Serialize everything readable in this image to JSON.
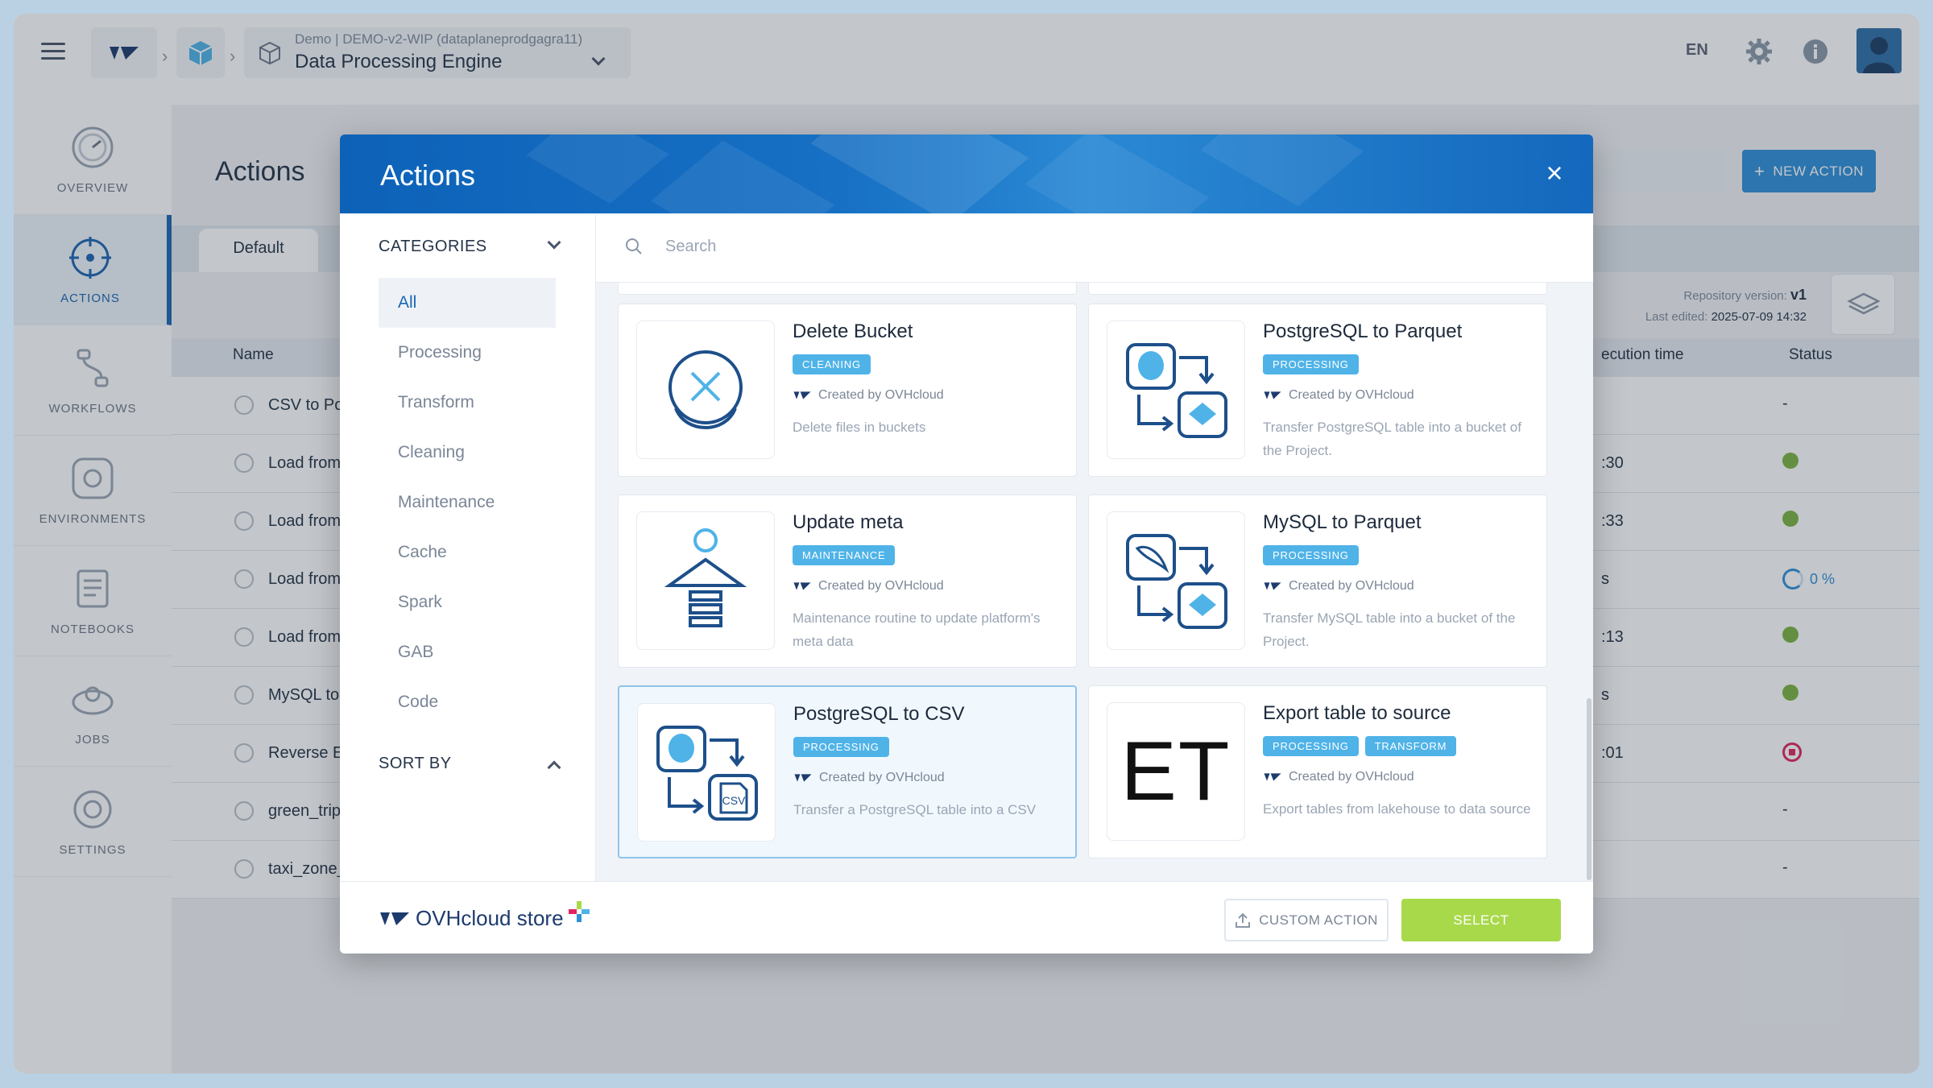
{
  "topbar": {
    "project_sub": "Demo | DEMO-v2-WIP (dataplaneprodgagra11)",
    "project_title": "Data Processing Engine",
    "lang": "EN",
    "colors": {
      "brand": "#0d62b8",
      "accent": "#2f8fd8"
    }
  },
  "sidebar": {
    "items": [
      {
        "label": "OVERVIEW",
        "icon": "gauge-icon"
      },
      {
        "label": "ACTIONS",
        "icon": "target-icon"
      },
      {
        "label": "WORKFLOWS",
        "icon": "workflow-icon"
      },
      {
        "label": "ENVIRONMENTS",
        "icon": "environment-icon"
      },
      {
        "label": "NOTEBOOKS",
        "icon": "notebook-icon"
      },
      {
        "label": "JOBS",
        "icon": "jobs-icon"
      },
      {
        "label": "SETTINGS",
        "icon": "gear-icon"
      }
    ]
  },
  "page": {
    "title": "Actions",
    "tab": "Default",
    "new_action": "NEW ACTION",
    "repo_label": "Repository version:",
    "repo_value": "v1",
    "last_edited_label": "Last edited:",
    "last_edited_value": "2025-07-09 14:32",
    "columns": {
      "name": "Name",
      "exec": "ecution time",
      "status": "Status"
    },
    "rows": [
      {
        "name": "CSV to Post",
        "exec": "",
        "status": "-"
      },
      {
        "name": "Load from t",
        "exec": ":30",
        "status": "ok"
      },
      {
        "name": "Load from t",
        "exec": ":33",
        "status": "ok"
      },
      {
        "name": "Load from t",
        "exec": "s",
        "status": "progress",
        "pct": "0 %"
      },
      {
        "name": "Load from y",
        "exec": ":13",
        "status": "ok"
      },
      {
        "name": "MySQL to P",
        "exec": "s",
        "status": "ok"
      },
      {
        "name": "Reverse ET",
        "exec": ":01",
        "status": "error"
      },
      {
        "name": "green_tripd",
        "exec": "",
        "status": "-"
      },
      {
        "name": "taxi_zone_",
        "exec": "",
        "status": "-"
      }
    ]
  },
  "modal": {
    "title": "Actions",
    "close": "×",
    "categories_label": "CATEGORIES",
    "categories": [
      "All",
      "Processing",
      "Transform",
      "Cleaning",
      "Maintenance",
      "Cache",
      "Spark",
      "GAB",
      "Code"
    ],
    "sort_label": "SORT BY",
    "search_placeholder": "Search",
    "cards": [
      {
        "title": "Delete Bucket",
        "badges": [
          "CLEANING"
        ],
        "by": "Created by OVHcloud",
        "desc": "Delete files in buckets",
        "icon": "delete-bucket-icon"
      },
      {
        "title": "PostgreSQL to Parquet",
        "badges": [
          "PROCESSING"
        ],
        "by": "Created by OVHcloud",
        "desc": "Transfer PostgreSQL table into a bucket of the Project.",
        "icon": "postgres-to-parquet-icon"
      },
      {
        "title": "Update meta",
        "badges": [
          "MAINTENANCE"
        ],
        "by": "Created by OVHcloud",
        "desc": "Maintenance routine to update platform's meta data",
        "icon": "update-meta-icon"
      },
      {
        "title": "MySQL to Parquet",
        "badges": [
          "PROCESSING"
        ],
        "by": "Created by OVHcloud",
        "desc": "Transfer MySQL table into a bucket of the Project.",
        "icon": "mysql-to-parquet-icon"
      },
      {
        "title": "PostgreSQL to CSV",
        "badges": [
          "PROCESSING"
        ],
        "by": "Created by OVHcloud",
        "desc": "Transfer a PostgreSQL table into a CSV",
        "icon": "postgres-to-csv-icon",
        "csv_label": "CSV"
      },
      {
        "title": "Export table to source",
        "badges": [
          "PROCESSING",
          "TRANSFORM"
        ],
        "by": "Created by OVHcloud",
        "desc": "Export tables from lakehouse to data source",
        "icon": "et-icon",
        "thumb_text": "ET"
      }
    ],
    "store_label": "OVHcloud store",
    "custom_action": "CUSTOM ACTION",
    "select": "SELECT"
  }
}
